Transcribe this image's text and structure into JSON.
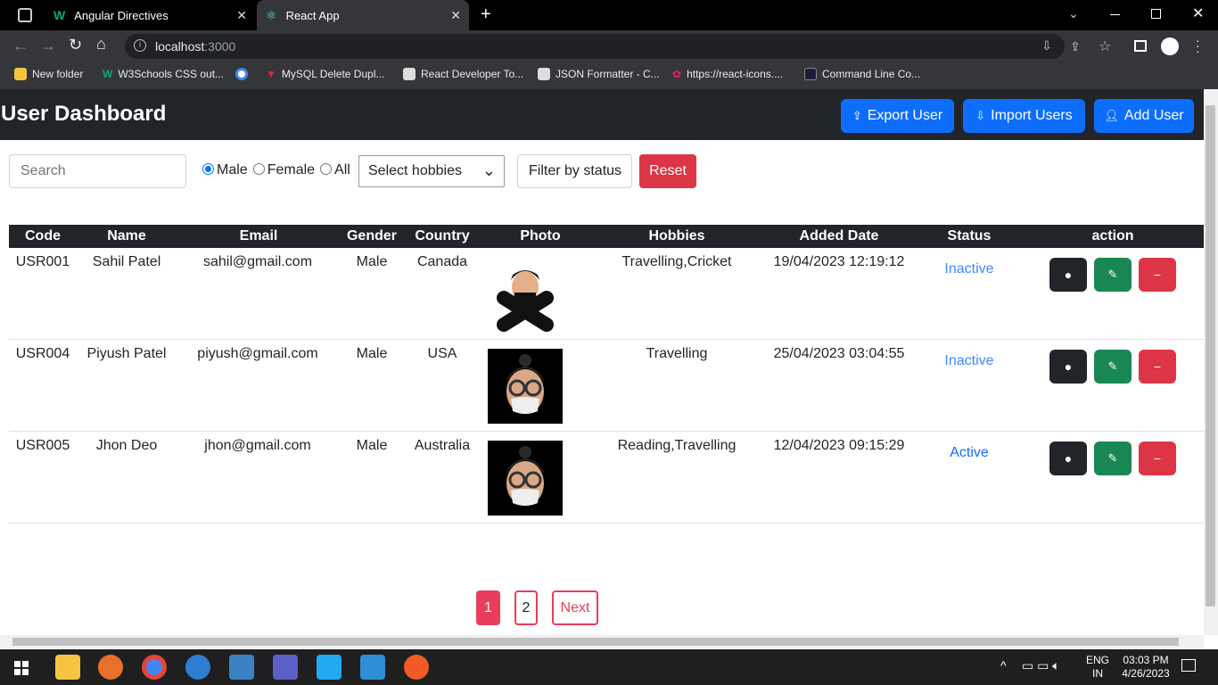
{
  "browser": {
    "tabs": [
      {
        "title": "Angular Directives",
        "icon": "w3schools-icon"
      },
      {
        "title": "React App",
        "icon": "react-icon"
      }
    ],
    "url_host": "localhost",
    "url_port": ":3000",
    "bookmarks": [
      {
        "label": "New folder",
        "icon": "folder-icon"
      },
      {
        "label": "W3Schools CSS out...",
        "icon": "w3schools-icon"
      },
      {
        "label": "",
        "icon": "google-icon"
      },
      {
        "label": "MySQL Delete Dupl...",
        "icon": "vivid-icon"
      },
      {
        "label": "React Developer To...",
        "icon": "bookmark-icon"
      },
      {
        "label": "JSON Formatter - C...",
        "icon": "bookmark-icon"
      },
      {
        "label": "https://react-icons....",
        "icon": "react-icon"
      },
      {
        "label": "Command Line Co...",
        "icon": "angular-icon"
      }
    ]
  },
  "header": {
    "title": "User Dashboard",
    "export_label": "Export User",
    "import_label": "Import Users",
    "add_label": "Add User"
  },
  "filters": {
    "search_placeholder": "Search",
    "gender_options": [
      "Male",
      "Female",
      "All"
    ],
    "gender_selected": "Male",
    "hobbies_label": "Select hobbies",
    "status_label": "Filter by status",
    "reset_label": "Reset"
  },
  "table": {
    "columns": [
      "Code",
      "Name",
      "Email",
      "Gender",
      "Country",
      "Photo",
      "Hobbies",
      "Added Date",
      "Status",
      "action"
    ],
    "rows": [
      {
        "code": "USR001",
        "name": "Sahil Patel",
        "email": "sahil@gmail.com",
        "gender": "Male",
        "country": "Canada",
        "hobbies": "Travelling,Cricket",
        "date": "19/04/2023 12:19:12",
        "status": "Inactive"
      },
      {
        "code": "USR004",
        "name": "Piyush Patel",
        "email": "piyush@gmail.com",
        "gender": "Male",
        "country": "USA",
        "hobbies": "Travelling",
        "date": "25/04/2023 03:04:55",
        "status": "Inactive"
      },
      {
        "code": "USR005",
        "name": "Jhon Deo",
        "email": "jhon@gmail.com",
        "gender": "Male",
        "country": "Australia",
        "hobbies": "Reading,Travelling",
        "date": "12/04/2023 09:15:29",
        "status": "Active"
      }
    ]
  },
  "pagination": {
    "pages": [
      "1",
      "2"
    ],
    "current": "1",
    "next_label": "Next"
  },
  "taskbar": {
    "lang": "ENG",
    "region": "IN",
    "time": "03:03 PM",
    "date": "4/26/2023"
  },
  "colors": {
    "primary": "#0d6efd",
    "dark": "#212529",
    "success": "#198754",
    "danger": "#dc3545"
  }
}
